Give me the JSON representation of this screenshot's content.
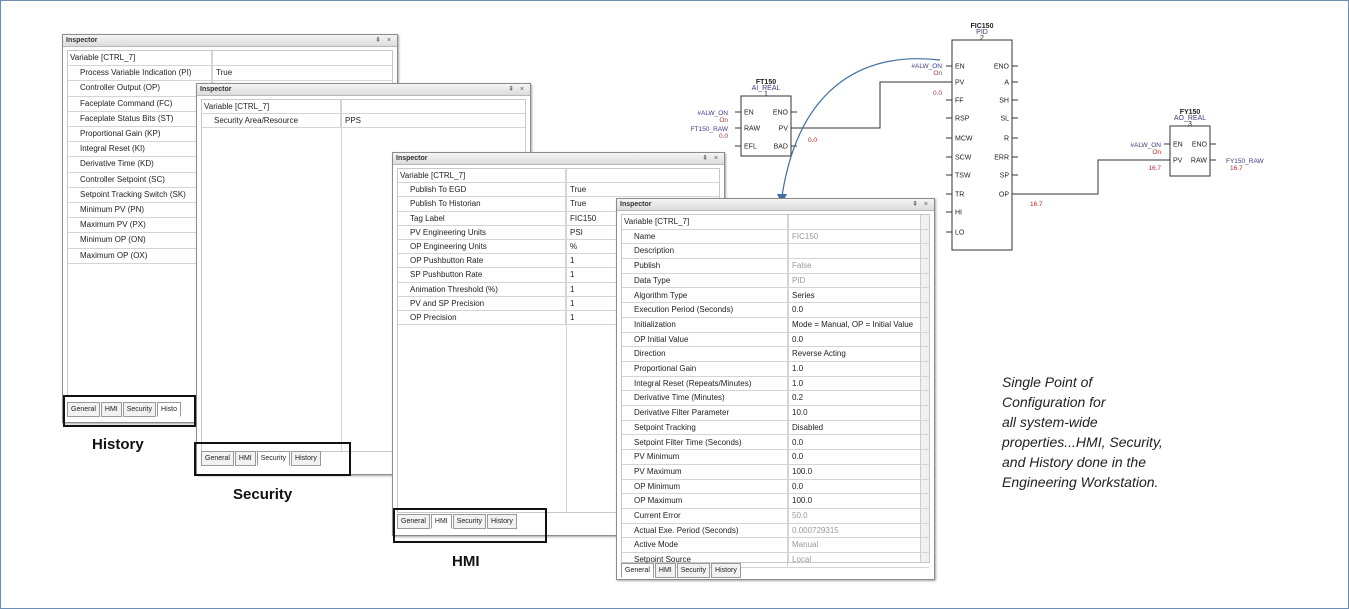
{
  "win1": {
    "title": "Inspector",
    "controls": "⇞ ×",
    "rows": [
      {
        "k": "Variable [CTRL_7]",
        "v": ""
      },
      {
        "k": "Process Variable Indication (PI)",
        "v": "True"
      },
      {
        "k": "Controller Output (OP)",
        "v": ""
      },
      {
        "k": "Faceplate Command (FC)",
        "v": ""
      },
      {
        "k": "Faceplate Status Bits (ST)",
        "v": ""
      },
      {
        "k": "Proportional Gain (KP)",
        "v": ""
      },
      {
        "k": "Integral Reset (KI)",
        "v": ""
      },
      {
        "k": "Derivative Time (KD)",
        "v": ""
      },
      {
        "k": "Controller Setpoint (SC)",
        "v": ""
      },
      {
        "k": "Setpoint Tracking Switch (SK)",
        "v": ""
      },
      {
        "k": "Minimum PV (PN)",
        "v": ""
      },
      {
        "k": "Maximum PV (PX)",
        "v": ""
      },
      {
        "k": "Minimum OP (ON)",
        "v": ""
      },
      {
        "k": "Maximum OP (OX)",
        "v": ""
      }
    ],
    "tabs": [
      "General",
      "HMI",
      "Security",
      "Histo"
    ]
  },
  "win2": {
    "title": "Inspector",
    "controls": "⇞ ×",
    "rows": [
      {
        "k": "Variable [CTRL_7]",
        "v": ""
      },
      {
        "k": "Security Area/Resource",
        "v": "PPS"
      }
    ],
    "tabs": [
      "General",
      "HMI",
      "Security",
      "History"
    ]
  },
  "win3": {
    "title": "Inspector",
    "controls": "⇞ ×",
    "rows": [
      {
        "k": "Variable [CTRL_7]",
        "v": ""
      },
      {
        "k": "Publish To EGD",
        "v": "True"
      },
      {
        "k": "Publish To Historian",
        "v": "True"
      },
      {
        "k": "Tag Label",
        "v": "FIC150"
      },
      {
        "k": "PV Engineering Units",
        "v": "PSI"
      },
      {
        "k": "OP Engineering Units",
        "v": "%"
      },
      {
        "k": "OP Pushbutton Rate",
        "v": "1"
      },
      {
        "k": "SP Pushbutton Rate",
        "v": "1"
      },
      {
        "k": "Animation Threshold (%)",
        "v": "1"
      },
      {
        "k": "PV and SP Precision",
        "v": "1"
      },
      {
        "k": "OP Precision",
        "v": "1"
      }
    ],
    "tabs": [
      "General",
      "HMI",
      "Security",
      "History"
    ]
  },
  "win4": {
    "title": "Inspector",
    "controls": "⇞ ×",
    "rows": [
      {
        "k": "Variable [CTRL_7]",
        "v": "",
        "dim": false
      },
      {
        "k": "Name",
        "v": "FIC150",
        "dim": true
      },
      {
        "k": "Description",
        "v": "",
        "dim": false
      },
      {
        "k": "Publish",
        "v": "False",
        "dim": true
      },
      {
        "k": "Data Type",
        "v": "PID",
        "dim": true
      },
      {
        "k": "Algorithm Type",
        "v": "Series",
        "dim": false
      },
      {
        "k": "Execution Period (Seconds)",
        "v": "0.0",
        "dim": false
      },
      {
        "k": "Initialization",
        "v": "Mode = Manual, OP = Initial Value",
        "dim": false
      },
      {
        "k": "OP Initial Value",
        "v": "0.0",
        "dim": false
      },
      {
        "k": "Direction",
        "v": "Reverse Acting",
        "dim": false
      },
      {
        "k": "Proportional Gain",
        "v": "1.0",
        "dim": false
      },
      {
        "k": "Integral Reset (Repeats/Minutes)",
        "v": "1.0",
        "dim": false
      },
      {
        "k": "Derivative Time (Minutes)",
        "v": "0.2",
        "dim": false
      },
      {
        "k": "Derivative Filter Parameter",
        "v": "10.0",
        "dim": false
      },
      {
        "k": "Setpoint Tracking",
        "v": "Disabled",
        "dim": false
      },
      {
        "k": "Setpoint Filter Time (Seconds)",
        "v": "0.0",
        "dim": false
      },
      {
        "k": "PV Minimum",
        "v": "0.0",
        "dim": false
      },
      {
        "k": "PV Maximum",
        "v": "100.0",
        "dim": false
      },
      {
        "k": "OP Minimum",
        "v": "0.0",
        "dim": false
      },
      {
        "k": "OP Maximum",
        "v": "100.0",
        "dim": false
      },
      {
        "k": "Current Error",
        "v": "50.0",
        "dim": true
      },
      {
        "k": "Actual Exe. Period (Seconds)",
        "v": "0.000729315",
        "dim": true
      },
      {
        "k": "Active Mode",
        "v": "Manual",
        "dim": true
      },
      {
        "k": "Setpoint Source",
        "v": "Local",
        "dim": true
      }
    ],
    "tabs": [
      "General",
      "HMI",
      "Security",
      "History"
    ]
  },
  "labels": {
    "history": "History",
    "security": "Security",
    "hmi": "HMI"
  },
  "caption": "Single Point of\nConfiguration for\nall system-wide\nproperties...HMI, Security,\nand History done in the\nEngineering Workstation.",
  "diagram": {
    "ft150": {
      "name": "FT150",
      "type": "AI_REAL",
      "num": "1",
      "in_en": "#ALW_ON",
      "in_en_state": "On",
      "in_raw": "FT150_RAW",
      "in_raw_val": "0.0",
      "pins_left": [
        "EN",
        "RAW",
        "EFL"
      ],
      "pins_right": [
        "ENO",
        "PV",
        "BAD"
      ],
      "pv_val": "0.0"
    },
    "fic150": {
      "name": "FIC150",
      "type": "PID",
      "num": "2",
      "in_en": "#ALW_ON",
      "in_en_state": "On",
      "pv_in": "0.0",
      "pins_left": [
        "EN",
        "PV",
        "FF",
        "RSP",
        "MCW",
        "SCW",
        "TSW",
        "TR",
        "HI",
        "LO"
      ],
      "pins_right": [
        "ENO",
        "A",
        "SH",
        "SL",
        "R",
        "ERR",
        "SP",
        "OP"
      ],
      "op_val": "16.7"
    },
    "fy150": {
      "name": "FY150",
      "type": "AO_REAL",
      "num": "3",
      "in_en": "#ALW_ON",
      "in_en_state": "On",
      "pv_in": "16.7",
      "pins_left": [
        "EN",
        "PV"
      ],
      "pins_right": [
        "ENO",
        "RAW"
      ],
      "raw_out": "FY150_RAW",
      "raw_val": "16.7"
    }
  },
  "colors": {
    "frame": "#6e8db5",
    "arrow": "#3f6fa3",
    "pinlabel": "#3a3a80",
    "redtext": "#b03030"
  }
}
